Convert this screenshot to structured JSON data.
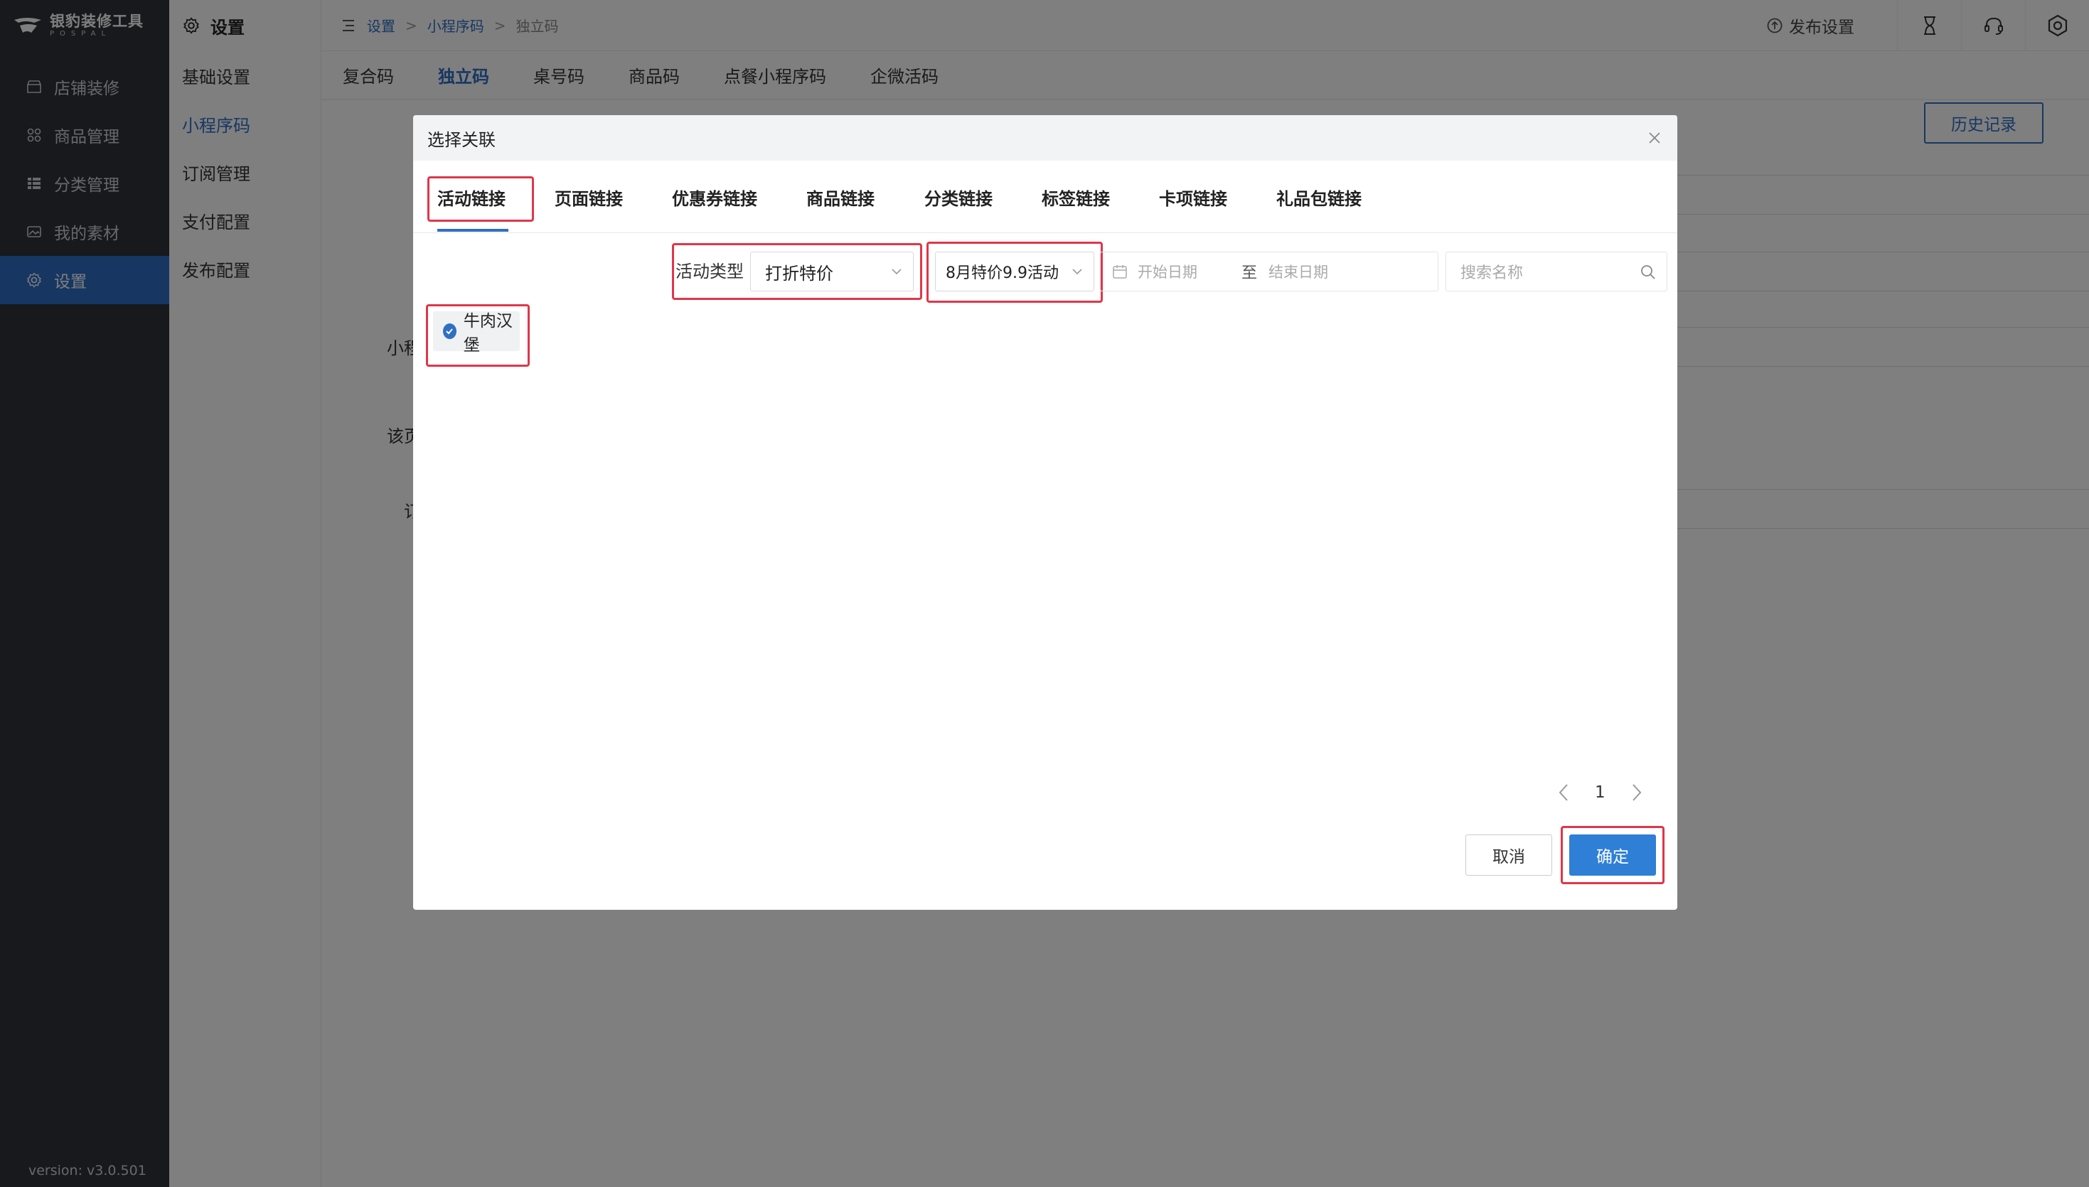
{
  "app": {
    "logo_title": "银豹装修工具",
    "logo_sub": "POSPAL",
    "version": "version: v3.0.501"
  },
  "sidebar": {
    "items": [
      {
        "label": "店铺装修",
        "icon": "shop-icon"
      },
      {
        "label": "商品管理",
        "icon": "grid-icon"
      },
      {
        "label": "分类管理",
        "icon": "list-icon"
      },
      {
        "label": "我的素材",
        "icon": "image-icon"
      },
      {
        "label": "设置",
        "icon": "gear-icon",
        "active": true
      }
    ]
  },
  "submenu": {
    "title": "设置",
    "items": [
      {
        "label": "基础设置"
      },
      {
        "label": "小程序码",
        "active": true
      },
      {
        "label": "订阅管理"
      },
      {
        "label": "支付配置"
      },
      {
        "label": "发布配置"
      }
    ]
  },
  "breadcrumb": {
    "items": [
      "设置",
      "小程序码",
      "独立码"
    ]
  },
  "topbar": {
    "publish_label": "发布设置"
  },
  "code_tabs": [
    "复合码",
    "独立码",
    "桌号码",
    "商品码",
    "点餐小程序码",
    "企微活码"
  ],
  "main": {
    "history_button": "历史记录",
    "partial_label_1": "小程",
    "partial_label_2": "该页",
    "partial_label_3": "订"
  },
  "dialog": {
    "title": "选择关联",
    "tabs": [
      "活动链接",
      "页面链接",
      "优惠券链接",
      "商品链接",
      "分类链接",
      "标签链接",
      "卡项链接",
      "礼品包链接"
    ],
    "filter_label": "活动类型",
    "activity_type_value": "打折特价",
    "activity_value": "8月特价9.9活动",
    "date_start_placeholder": "开始日期",
    "date_to": "至",
    "date_end_placeholder": "结束日期",
    "search_placeholder": "搜索名称",
    "items": [
      {
        "label": "牛肉汉堡",
        "selected": true
      }
    ],
    "pager": {
      "current": "1"
    },
    "cancel_label": "取消",
    "ok_label": "确定"
  },
  "colors": {
    "accent": "#2f6fc5",
    "highlight": "#e0364a",
    "sidebar_bg": "#2f3338"
  }
}
